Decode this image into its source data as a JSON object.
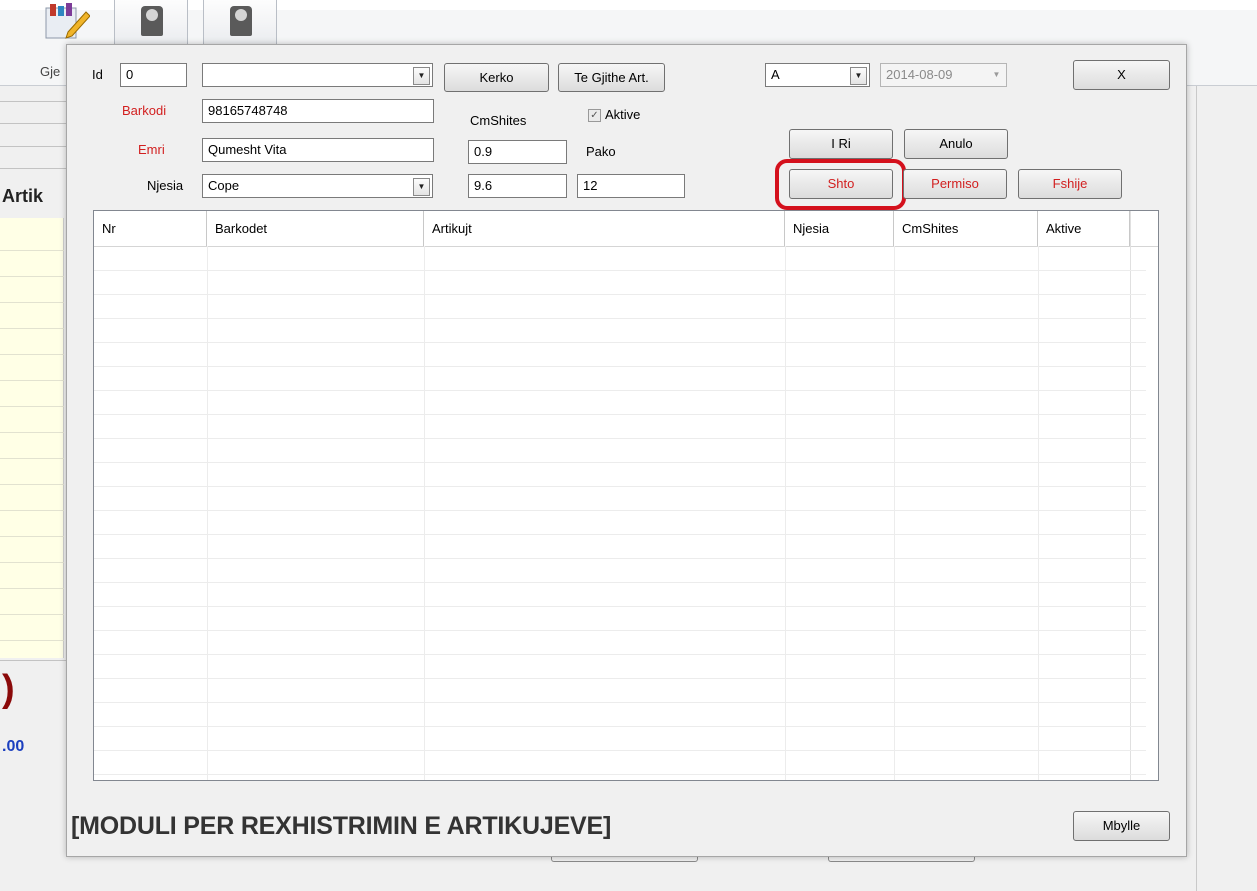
{
  "background": {
    "ribbon_label_partial": "Gje",
    "section_label_partial": "Artik",
    "big_value_partial": ")",
    "amount_partial": ".00"
  },
  "form": {
    "id_label": "Id",
    "id_value": "0",
    "top_combo_value": "",
    "search_button": "Kerko",
    "all_articles_button": "Te Gjithe Art.",
    "barcode_label": "Barkodi",
    "barcode_value": "98165748748",
    "name_label": "Emri",
    "name_value": "Qumesht Vita",
    "unit_label": "Njesia",
    "unit_value": "Cope",
    "price_label": "CmShites",
    "price_value": "0.9",
    "price_value2": "9.6",
    "active_label": "Aktive",
    "active_checked": true,
    "package_label": "Pako",
    "package_value": "12",
    "type_combo_value": "A",
    "date_value": "2014-08-09",
    "close_x_button": "X",
    "new_button": "I Ri",
    "cancel_button": "Anulo",
    "add_button": "Shto",
    "modify_button": "Permiso",
    "delete_button": "Fshije"
  },
  "grid": {
    "columns": [
      "Nr",
      "Barkodet",
      "Artikujt",
      "Njesia",
      "CmShites",
      "Aktive"
    ],
    "rows": []
  },
  "footer": {
    "module_title": "[MODULI PER REXHISTRIMIN E ARTIKUJEVE]",
    "close_button": "Mbylle"
  },
  "colors": {
    "highlight": "#d4101c",
    "red_label": "#d21f1f",
    "blue_amount": "#1b3fbf",
    "darkred_value": "#8b0a0a"
  }
}
